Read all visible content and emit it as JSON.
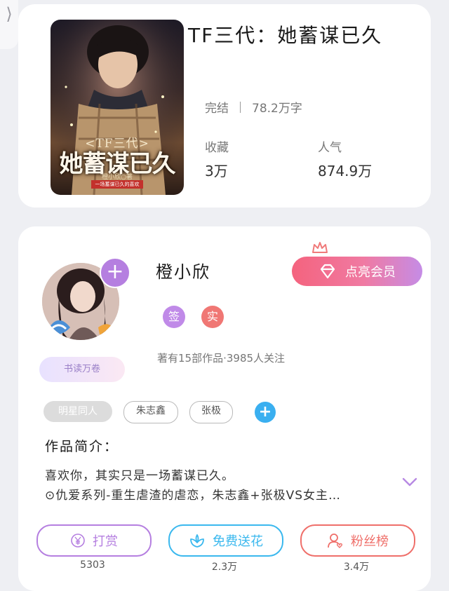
{
  "nav": {
    "back_glyph": "⟩"
  },
  "book": {
    "title": "TF三代：她蓄谋已久",
    "status": "完结",
    "word_count": "78.2万字",
    "stats": [
      {
        "label": "收藏",
        "value": "3万"
      },
      {
        "label": "人气",
        "value": "874.9万"
      }
    ],
    "cover": {
      "tag": "<TF三代>",
      "title": "她蓄谋已久",
      "author": "橙小欣○著",
      "slogan": "一场蓄谋已久的喜欢"
    }
  },
  "author": {
    "name": "橙小欣",
    "badge": "书读万卷",
    "tags": [
      "签",
      "实"
    ],
    "meta": "著有15部作品·3985人关注",
    "vip_label": "点亮会员"
  },
  "chips": [
    "明星同人",
    "朱志鑫",
    "张极"
  ],
  "intro": {
    "title": "作品简介：",
    "lines": [
      "喜欢你，其实只是一场蓄谋已久。",
      "⊙仇爱系列-重生虐渣的虐恋，朱志鑫+张极VS女主…"
    ]
  },
  "actions": [
    {
      "label": "打赏",
      "count": "5303",
      "color": "#b57fe0"
    },
    {
      "label": "免费送花",
      "count": "2.3万",
      "color": "#3ab8ee"
    },
    {
      "label": "粉丝榜",
      "count": "3.4万",
      "color": "#ef6f6a"
    }
  ],
  "colors": {
    "vip_gradient_start": "#f4637e",
    "vip_gradient_end": "#c58ce6",
    "sign_tag": "#c08ae8",
    "real_tag": "#f07774",
    "add_chip": "#3aaff0"
  },
  "icons": [
    "back-chevron-icon",
    "plus-icon",
    "crown-icon",
    "diamond-icon",
    "yen-icon",
    "flower-icon",
    "user-icon",
    "chevron-down-icon"
  ]
}
